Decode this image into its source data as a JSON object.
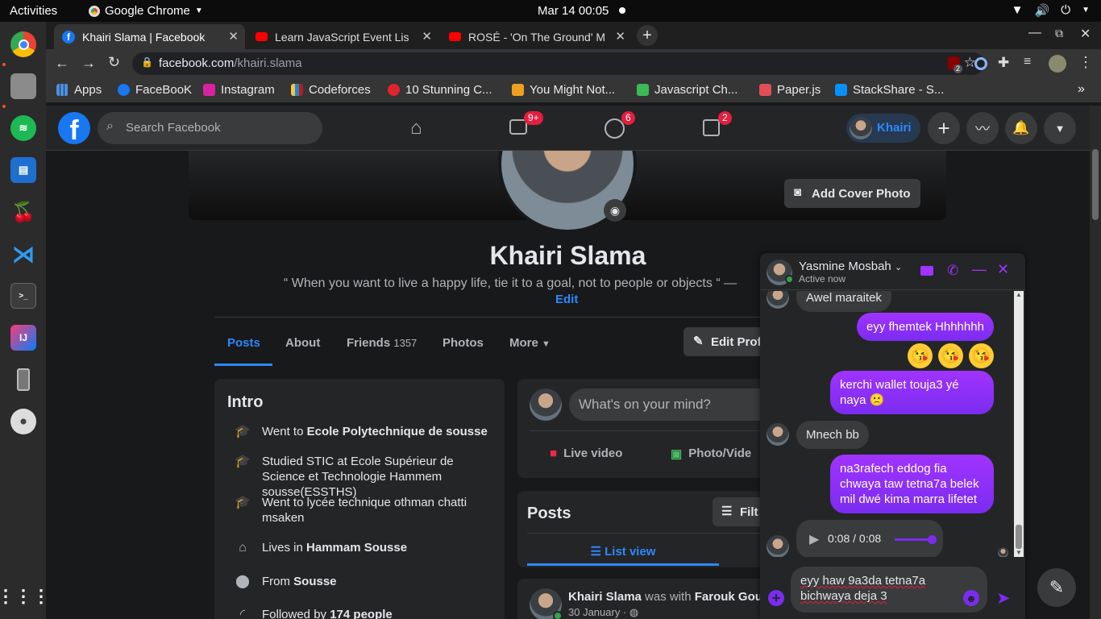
{
  "desktop": {
    "activities": "Activities",
    "app_name": "Google Chrome",
    "clock": "Mar 14  00:05"
  },
  "browser": {
    "tabs": [
      {
        "title": "Khairi Slama | Facebook"
      },
      {
        "title": "Learn JavaScript Event Lis"
      },
      {
        "title": "ROSÉ - 'On The Ground' M"
      }
    ],
    "url_host": "facebook.com",
    "url_path": "/khairi.slama",
    "extension_badge": "2",
    "bookmarks": [
      {
        "label": "Apps",
        "color": "#4a90e2"
      },
      {
        "label": "FaceBooK",
        "color": "#1877f2"
      },
      {
        "label": "Instagram",
        "color": "#d6249f"
      },
      {
        "label": "Codeforces",
        "color": "#1f8acb"
      },
      {
        "label": "10 Stunning C...",
        "color": "#e0242e"
      },
      {
        "label": "You Might Not...",
        "color": "#f0a020"
      },
      {
        "label": "Javascript Ch...",
        "color": "#3cba54"
      },
      {
        "label": "Paper.js",
        "color": "#e04e58"
      },
      {
        "label": "StackShare - S...",
        "color": "#0690fa"
      }
    ]
  },
  "fb": {
    "search_placeholder": "Search Facebook",
    "badges": {
      "watch": "9+",
      "groups": "6",
      "gaming": "2"
    },
    "profile_chip": "Khairi",
    "add_cover": "Add Cover Photo",
    "name": "Khairi Slama",
    "quote": "“ When you want to live a happy life, tie it to a goal, not to people or objects “ —",
    "edit_link": "Edit",
    "tabs": {
      "posts": "Posts",
      "about": "About",
      "friends": "Friends",
      "friends_count": "1357",
      "photos": "Photos",
      "more": "More"
    },
    "edit_profile": "Edit Prof",
    "intro": {
      "title": "Intro",
      "items": [
        {
          "prefix": "Went to ",
          "bold": "Ecole Polytechnique de sousse",
          "icon": "graduation-cap-icon"
        },
        {
          "prefix": "Studied STIC at Ecole Supérieur de Science et Technologie Hammem sousse(ESSTHS)",
          "bold": "",
          "icon": "graduation-cap-icon"
        },
        {
          "prefix": "Went to lycée technique othman chatti msaken",
          "bold": "",
          "icon": "graduation-cap-icon"
        },
        {
          "prefix": "Lives in ",
          "bold": "Hammam Sousse",
          "icon": "home-icon"
        },
        {
          "prefix": "From ",
          "bold": "Sousse",
          "icon": "location-pin-icon"
        },
        {
          "prefix": "Followed by ",
          "bold": "174 people",
          "icon": "rss-icon"
        }
      ]
    },
    "composer": {
      "placeholder": "What's on your mind?",
      "live": "Live video",
      "photo": "Photo/Vide"
    },
    "posts_card": {
      "title": "Posts",
      "filter": "Filt",
      "list_view": "List view"
    },
    "post": {
      "author": "Khairi Slama",
      "with_text": " was with ",
      "with_name": "Farouk Gou",
      "date": "30 January ·"
    }
  },
  "chat": {
    "contact": "Yasmine Mosbah",
    "status": "Active now",
    "messages": [
      {
        "text": "Awel maraitek"
      },
      {
        "text": "eyy fhemtek Hhhhhhh"
      },
      {
        "text": "kerchi wallet touja3 yé naya 🙁"
      },
      {
        "text": "Mnech bb"
      },
      {
        "text": "na3rafech eddog fia chwaya taw tetna7a belek mil dwé kima marra lifetet"
      }
    ],
    "emojis": [
      "😘",
      "😘",
      "😘"
    ],
    "audio_time": "0:08 / 0:08",
    "audio_progress": 1.0,
    "draft": "eyy haw 9a3da tetna7a bichwaya deja 3"
  }
}
